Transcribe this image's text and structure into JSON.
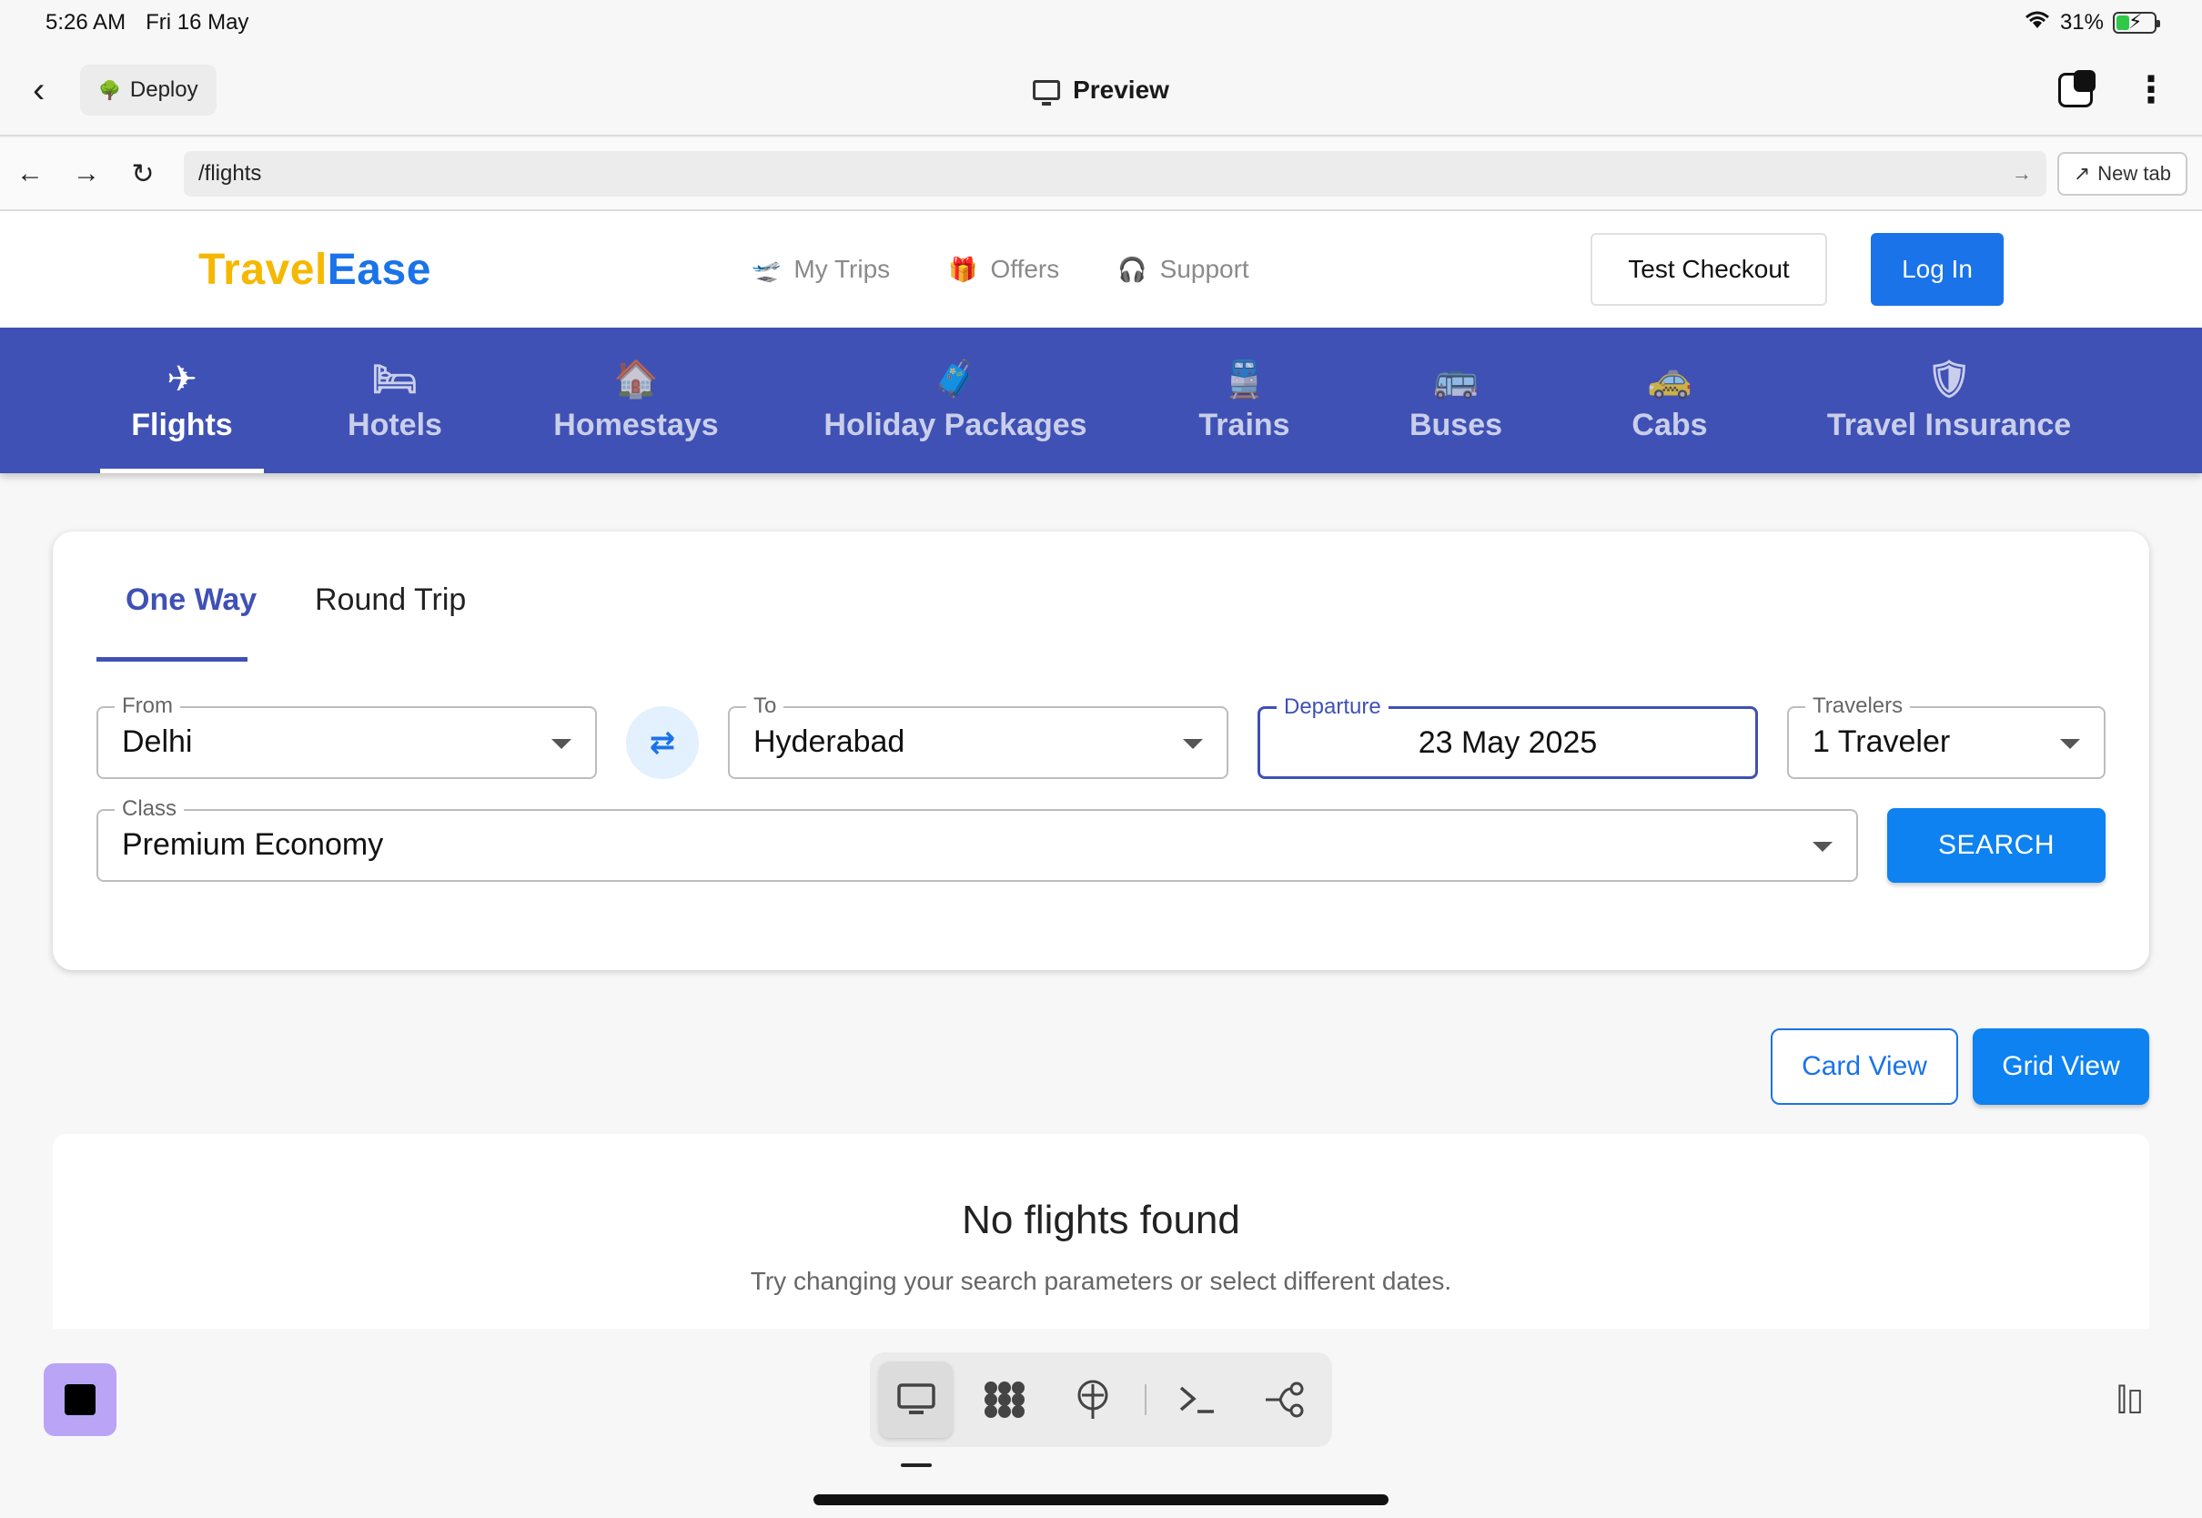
{
  "status_bar": {
    "time": "5:26 AM",
    "date": "Fri 16 May",
    "battery": "31%"
  },
  "app_bar": {
    "deploy_label": "Deploy",
    "title": "Preview"
  },
  "browser": {
    "url": "/flights",
    "new_tab_label": "New tab"
  },
  "site": {
    "logo_part1": "Travel",
    "logo_part2": "Ease",
    "nav": [
      {
        "label": "My Trips",
        "icon": "plane-takeoff-icon"
      },
      {
        "label": "Offers",
        "icon": "gift-icon"
      },
      {
        "label": "Support",
        "icon": "headset-icon"
      }
    ],
    "checkout_label": "Test Checkout",
    "login_label": "Log In"
  },
  "categories": [
    {
      "label": "Flights",
      "icon": "airplane-icon",
      "active": true
    },
    {
      "label": "Hotels",
      "icon": "bed-icon",
      "active": false
    },
    {
      "label": "Homestays",
      "icon": "house-icon",
      "active": false
    },
    {
      "label": "Holiday Packages",
      "icon": "luggage-icon",
      "active": false
    },
    {
      "label": "Trains",
      "icon": "train-icon",
      "active": false
    },
    {
      "label": "Buses",
      "icon": "bus-icon",
      "active": false
    },
    {
      "label": "Cabs",
      "icon": "taxi-icon",
      "active": false
    },
    {
      "label": "Travel Insurance",
      "icon": "shield-icon",
      "active": false
    }
  ],
  "search": {
    "trip_types": [
      "One Way",
      "Round Trip"
    ],
    "active_trip_type": "One Way",
    "from": {
      "label": "From",
      "value": "Delhi"
    },
    "to": {
      "label": "To",
      "value": "Hyderabad"
    },
    "departure": {
      "label": "Departure",
      "value": "23 May 2025"
    },
    "travelers": {
      "label": "Travelers",
      "value": "1 Traveler"
    },
    "class": {
      "label": "Class",
      "value": "Premium Economy"
    },
    "search_label": "SEARCH"
  },
  "views": {
    "card_label": "Card View",
    "grid_label": "Grid View"
  },
  "results": {
    "empty_title": "No flights found",
    "empty_subtitle": "Try changing your search parameters or select different dates."
  },
  "colors": {
    "primary": "#3f51b5",
    "accent": "#1a73e8",
    "logo_yellow": "#f5b800",
    "button_blue": "#0d82f0"
  }
}
